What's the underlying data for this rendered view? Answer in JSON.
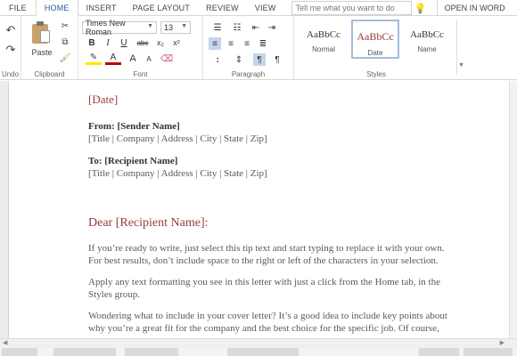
{
  "tabs": {
    "file": "FILE",
    "home": "HOME",
    "insert": "INSERT",
    "page_layout": "PAGE LAYOUT",
    "review": "REVIEW",
    "view": "VIEW",
    "tell_me_placeholder": "Tell me what you want to do",
    "open_in_word": "OPEN IN WORD"
  },
  "ribbon": {
    "undo": {
      "label": "Undo"
    },
    "clipboard": {
      "paste_label": "Paste",
      "group_label": "Clipboard"
    },
    "font": {
      "font_name": "Times New Roman",
      "font_size": "13",
      "bold": "B",
      "italic": "I",
      "underline": "U",
      "strikethrough": "abc",
      "subscript": "x₂",
      "superscript": "x²",
      "font_color_glyph": "A",
      "grow_glyph": "A",
      "shrink_glyph": "A",
      "group_label": "Font"
    },
    "paragraph": {
      "group_label": "Paragraph"
    },
    "styles": {
      "group_label": "Styles",
      "items": [
        {
          "sample": "AaBbCc",
          "name": "Normal"
        },
        {
          "sample": "AaBbCc",
          "name": "Date"
        },
        {
          "sample": "AaBbCc",
          "name": "Name"
        }
      ]
    }
  },
  "document": {
    "date": "[Date]",
    "from_label": "From: [Sender Name]",
    "from_details": "[Title | Company | Address | City | State | Zip]",
    "to_label": "To: [Recipient Name]",
    "to_details": "[Title | Company | Address | City | State | Zip]",
    "salutation": "Dear [Recipient Name]:",
    "para1_line1": "If you’re ready to write, just select this tip text and start typing to replace it with your own.",
    "para1_line2": "For best results, don’t include space to the right or left of the characters in your selection.",
    "para2_line1": "Apply any text formatting you see in this letter with just a click from the Home tab, in the",
    "para2_line2": "Styles group.",
    "para3_line1": "Wondering what to include in your cover letter? It’s a good idea to include key points about",
    "para3_line2": "why you’re a great fit for the company and the best choice for the specific job. Of course,"
  },
  "colors": {
    "accent_blue": "#2b579a",
    "date_red": "#9b3b3b",
    "selected_style_border": "#a4bcdc"
  }
}
